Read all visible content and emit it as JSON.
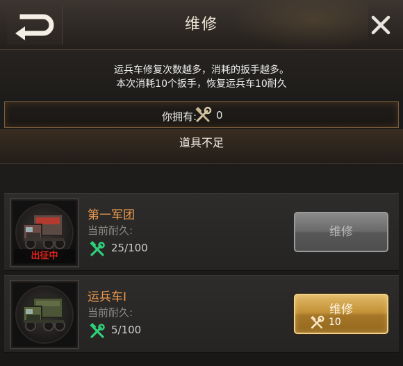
{
  "header": {
    "title": "维修"
  },
  "info": {
    "line1": "运兵车修复次数越多，消耗的扳手越多。",
    "line2": "本次消耗10个扳手，恢复运兵车10耐久"
  },
  "inventory": {
    "label": "你拥有:",
    "icon": "wrench-hammer-icon",
    "count": "0"
  },
  "warning": {
    "text": "道具不足"
  },
  "units": [
    {
      "name": "第一军团",
      "durability_label": "当前耐久:",
      "durability": "25/100",
      "status": "出征中",
      "button": {
        "label": "维修",
        "enabled": false
      }
    },
    {
      "name": "运兵车I",
      "durability_label": "当前耐久:",
      "durability": "5/100",
      "button": {
        "label": "维修",
        "enabled": true,
        "cost": "10"
      }
    }
  ],
  "colors": {
    "unit_name": "#ee9a4f",
    "status_red": "#e0241c",
    "button_gold": "#c49237",
    "button_gray": "#6a6a6a",
    "durability_icon_green": "#2fd07a"
  }
}
